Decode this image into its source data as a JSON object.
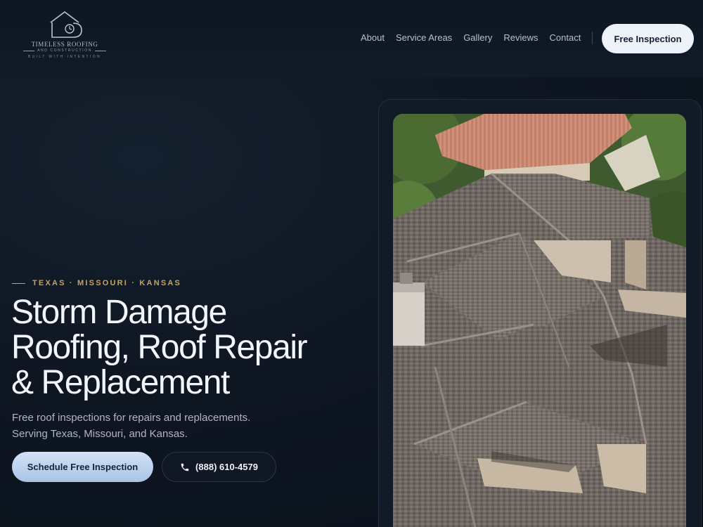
{
  "brand": {
    "name": "TIMELESS ROOFING",
    "subname": "AND CONSTRUCTION",
    "tagline": "BUILT WITH INTENTION"
  },
  "nav": {
    "items": [
      "About",
      "Service Areas",
      "Gallery",
      "Reviews",
      "Contact"
    ],
    "cta_label": "Free Inspection"
  },
  "hero": {
    "eyebrow": "TEXAS · MISSOURI · KANSAS",
    "title_lines": [
      "Storm Damage",
      "Roofing, Roof Repair",
      "& Replacement"
    ],
    "description_lines": [
      "Free roof inspections for repairs and replacements.",
      "Serving Texas, Missouri, and Kansas."
    ],
    "primary_button": "Schedule Free Inspection",
    "phone_button": "(888) 610-4579",
    "phone_icon": "phone-icon",
    "photo": "aerial-roof-photo"
  },
  "colors": {
    "accent_gold": "#c9a25c",
    "cta_light": "#eef3fa",
    "background": "#0e1622"
  }
}
